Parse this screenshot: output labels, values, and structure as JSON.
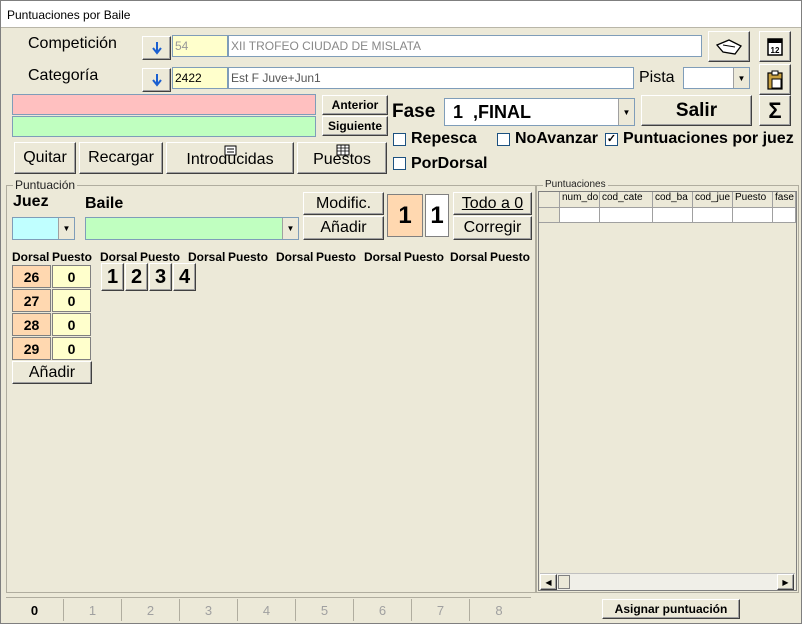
{
  "window": {
    "title": "Puntuaciones por Baile"
  },
  "competicion": {
    "label": "Competición",
    "code": "54",
    "name": "XII TROFEO CIUDAD DE MISLATA"
  },
  "categoria": {
    "label": "Categoría",
    "code": "2422",
    "name": "Est F Juve+Jun1"
  },
  "pista": {
    "label": "Pista",
    "value": ""
  },
  "nav": {
    "anterior": "Anterior",
    "siguiente": "Siguiente"
  },
  "fase": {
    "label": "Fase",
    "value": "1  ,FINAL"
  },
  "salir": "Salir",
  "sigma": "Σ",
  "options": {
    "repesca": {
      "label": "Repesca",
      "checked": false
    },
    "noavanzar": {
      "label": "NoAvanzar",
      "checked": false
    },
    "punt_por_juez": {
      "label": "Puntuaciones por juez",
      "checked": true
    },
    "pordorsal": {
      "label": "PorDorsal",
      "checked": false
    }
  },
  "check_mark": "✓",
  "toolbar": {
    "quitar": "Quitar",
    "recargar": "Recargar",
    "introducidas": "Introducidas",
    "puestos": "Puestos"
  },
  "puntuacion": {
    "group_label": "Puntuación",
    "juez_label": "Juez",
    "baile_label": "Baile",
    "modific": "Modific.",
    "anadir": "Añadir",
    "num1": "1",
    "num2": "1",
    "todo_a_0": "Todo a 0",
    "corregir": "Corregir",
    "col_headers": [
      "Dorsal",
      "Puesto",
      "Dorsal",
      "Puesto",
      "Dorsal",
      "Puesto",
      "Dorsal",
      "Puesto",
      "Dorsal",
      "Puesto",
      "Dorsal",
      "Puesto"
    ],
    "rows": [
      {
        "dorsal": "26",
        "puesto": "0"
      },
      {
        "dorsal": "27",
        "puesto": "0"
      },
      {
        "dorsal": "28",
        "puesto": "0"
      },
      {
        "dorsal": "29",
        "puesto": "0"
      }
    ],
    "place_buttons": [
      "1",
      "2",
      "3",
      "4"
    ],
    "anadir_bottom": "Añadir"
  },
  "puntuaciones": {
    "group_label": "Puntuaciones",
    "columns": [
      "num_do",
      "cod_cate",
      "cod_ba",
      "cod_jue",
      "Puesto",
      "fase"
    ]
  },
  "tabs": [
    "0",
    "1",
    "2",
    "3",
    "4",
    "5",
    "6",
    "7",
    "8"
  ],
  "asignar": "Asignar puntuación",
  "colors": {
    "pink": "#ffc0c0",
    "green": "#c0ffc0",
    "yellow": "#ffffcc",
    "orange": "#ffd8b0",
    "cyan": "#c0ffff"
  }
}
